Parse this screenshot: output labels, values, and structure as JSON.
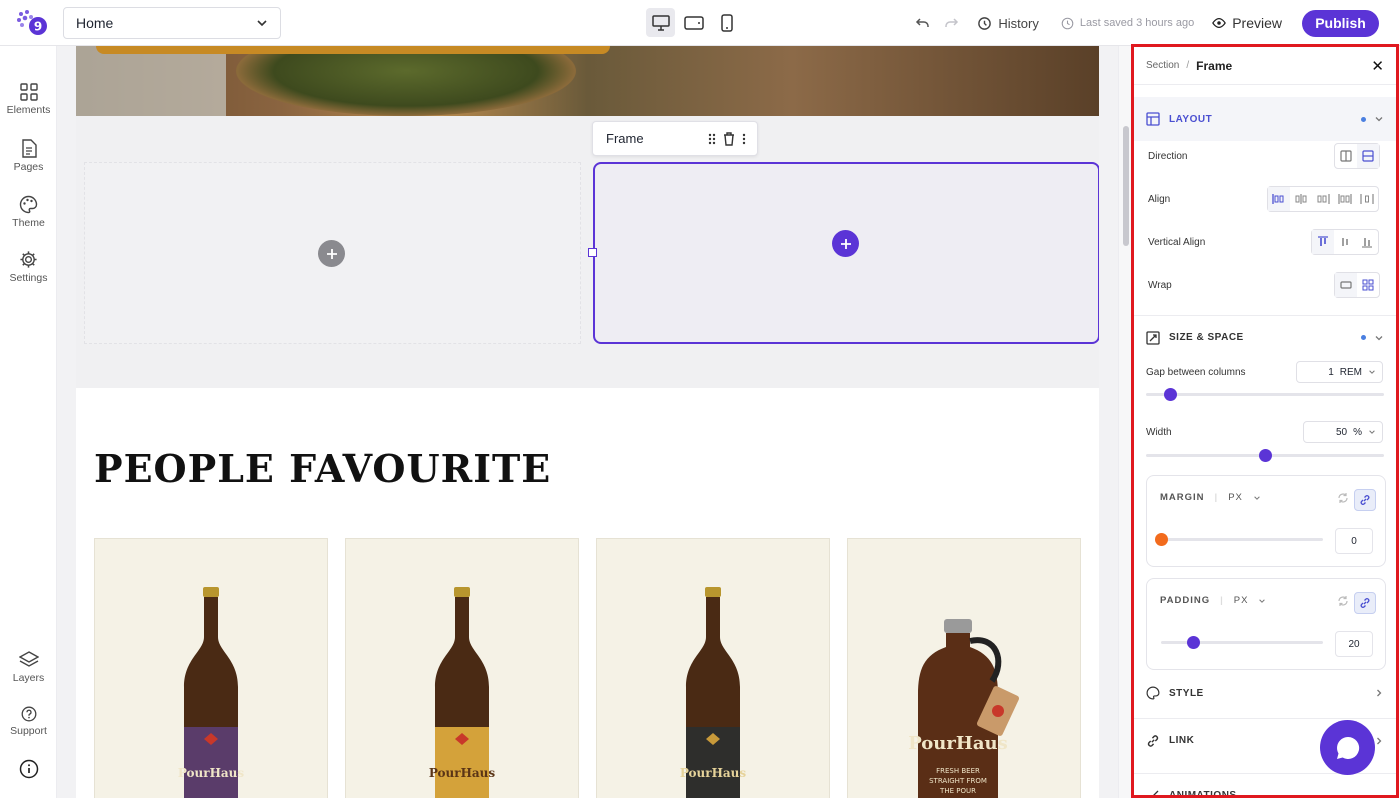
{
  "topbar": {
    "page_select": "Home",
    "history_label": "History",
    "last_saved": "Last saved 3 hours ago",
    "preview_label": "Preview",
    "publish_label": "Publish"
  },
  "leftnav": {
    "items": [
      {
        "label": "Elements",
        "icon": "grid-icon"
      },
      {
        "label": "Pages",
        "icon": "page-icon"
      },
      {
        "label": "Theme",
        "icon": "palette-icon"
      },
      {
        "label": "Settings",
        "icon": "gear-icon"
      }
    ],
    "bottom": [
      {
        "label": "Layers",
        "icon": "layers-icon"
      },
      {
        "label": "Support",
        "icon": "help-icon"
      }
    ]
  },
  "canvas": {
    "frame_toolbar_label": "Frame",
    "heading": "PEOPLE FAVOURITE",
    "products": [
      {
        "label_color": "#5a3c6a",
        "brand": "PourHaus"
      },
      {
        "label_color": "#d4a23a",
        "brand": "PourHaus"
      },
      {
        "label_color": "#2e2e2c",
        "brand": "PourHaus"
      },
      {
        "label_color": "#6a3a1e",
        "brand": "PourHaus",
        "tagline": "FRESH BEER STRAIGHT FROM THE POUR"
      }
    ]
  },
  "panel": {
    "breadcrumb_parent": "Section",
    "breadcrumb_current": "Frame",
    "layout": {
      "title": "LAYOUT",
      "direction_label": "Direction",
      "align_label": "Align",
      "vertical_align_label": "Vertical Align",
      "wrap_label": "Wrap"
    },
    "size_space": {
      "title": "SIZE & SPACE",
      "gap_label": "Gap between columns",
      "gap_value": "1",
      "gap_unit": "REM",
      "gap_slider": 0.1,
      "width_label": "Width",
      "width_value": "50",
      "width_unit": "%",
      "width_slider": 0.5
    },
    "margin": {
      "title": "MARGIN",
      "unit": "PX",
      "value": "0",
      "slider": 0.0
    },
    "padding": {
      "title": "PADDING",
      "unit": "PX",
      "value": "20",
      "slider": 0.2
    },
    "style_title": "STYLE",
    "link_title": "LINK",
    "animations_title": "ANIMATIONS"
  },
  "colors": {
    "accent": "#5b34d6",
    "highlight": "#e0181f",
    "margin_knob": "#f26b1d"
  }
}
